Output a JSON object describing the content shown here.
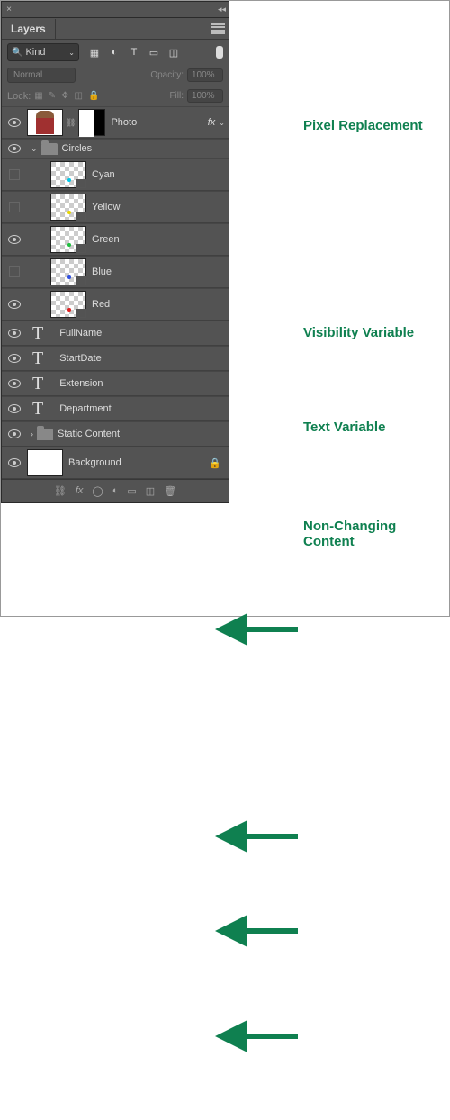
{
  "panel": {
    "title": "Layers"
  },
  "filter": {
    "kind_label": "Kind"
  },
  "blend": {
    "mode": "Normal",
    "opacity_label": "Opacity:",
    "opacity_value": "100%"
  },
  "lock": {
    "label": "Lock:",
    "fill_label": "Fill:",
    "fill_value": "100%"
  },
  "layers": {
    "photo": {
      "label": "Photo",
      "fx": "fx"
    },
    "circles": {
      "label": "Circles"
    },
    "circle_items": [
      {
        "label": "Cyan",
        "dot": "#00c8e8",
        "visible": false
      },
      {
        "label": "Yellow",
        "dot": "#e8d800",
        "visible": false
      },
      {
        "label": "Green",
        "dot": "#20c040",
        "visible": true
      },
      {
        "label": "Blue",
        "dot": "#3050e0",
        "visible": false
      },
      {
        "label": "Red",
        "dot": "#e02020",
        "visible": true
      }
    ],
    "text_items": [
      {
        "label": "FullName"
      },
      {
        "label": "StartDate"
      },
      {
        "label": "Extension"
      },
      {
        "label": "Department"
      }
    ],
    "static": {
      "label": "Static Content"
    },
    "background": {
      "label": "Background"
    }
  },
  "annotations": {
    "pixel": "Pixel Replacement",
    "visibility": "Visibility Variable",
    "text": "Text Variable",
    "nonchanging": "Non-Changing Content"
  }
}
